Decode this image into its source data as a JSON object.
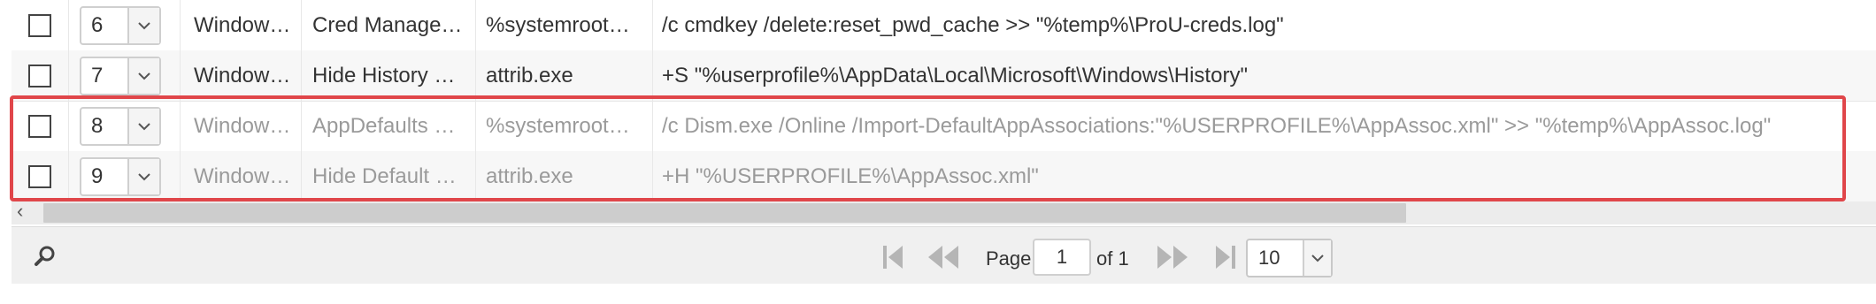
{
  "rows": [
    {
      "order": "6",
      "provider": "Window…",
      "name": "Cred Manage…",
      "command": "%systemroot…",
      "arguments": "/c cmdkey /delete:reset_pwd_cache >> \"%temp%\\ProU-creds.log\""
    },
    {
      "order": "7",
      "provider": "Window…",
      "name": "Hide History …",
      "command": "attrib.exe",
      "arguments": "+S \"%userprofile%\\AppData\\Local\\Microsoft\\Windows\\History\""
    },
    {
      "order": "8",
      "provider": "Window…",
      "name": "AppDefaults …",
      "command": "%systemroot…",
      "arguments": "/c Dism.exe /Online /Import-DefaultAppAssociations:\"%USERPROFILE%\\AppAssoc.xml\" >> \"%temp%\\AppAssoc.log\""
    },
    {
      "order": "9",
      "provider": "Window…",
      "name": "Hide Default …",
      "command": "attrib.exe",
      "arguments": "+H \"%USERPROFILE%\\AppAssoc.xml\""
    }
  ],
  "pager": {
    "page_label": "Page",
    "page_value": "1",
    "of_label": "of 1",
    "page_size": "10"
  },
  "colors": {
    "highlight": "#e0464a",
    "disabled_text": "#9a9a9a"
  },
  "icons": [
    "chevron-down-icon",
    "refresh-icon",
    "first-page-icon",
    "prev-page-icon",
    "next-page-icon",
    "last-page-icon",
    "scroll-left-icon"
  ]
}
